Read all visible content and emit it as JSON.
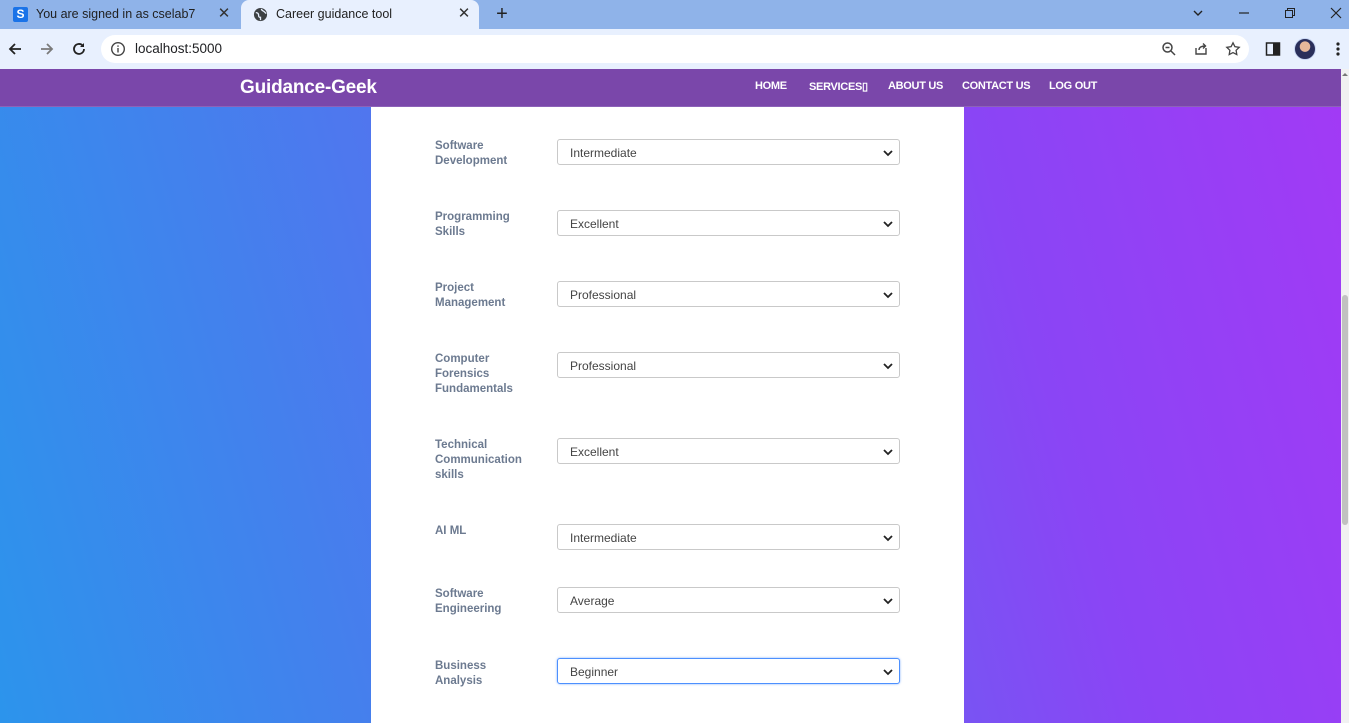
{
  "browser": {
    "tabs": [
      {
        "title": "You are signed in as cselab7",
        "favicon": "S"
      },
      {
        "title": "Career guidance tool",
        "favicon": "globe-icon"
      }
    ],
    "url": "localhost:5000"
  },
  "site": {
    "brand": "Guidance-Geek",
    "nav": [
      "HOME",
      "SERVICES▯",
      "ABOUT US",
      "CONTACT US",
      "LOG OUT"
    ]
  },
  "form": {
    "rows": [
      {
        "label": "Software Development",
        "value": "Intermediate"
      },
      {
        "label": "Programming Skills",
        "value": "Excellent"
      },
      {
        "label": "Project Management",
        "value": "Professional"
      },
      {
        "label": "Computer Forensics Fundamentals",
        "value": "Professional"
      },
      {
        "label": "Technical Communication skills",
        "value": "Excellent"
      },
      {
        "label": "AI ML",
        "value": "Intermediate"
      },
      {
        "label": "Software Engineering",
        "value": "Average"
      },
      {
        "label": "Business Analysis",
        "value": "Beginner"
      }
    ]
  },
  "colors": {
    "nav_bar": "#7a47aa",
    "gradient_left": "#2c94ec",
    "gradient_right": "#a23af5",
    "label_text": "#6c7a90",
    "focus_ring": "#4d90fe"
  }
}
